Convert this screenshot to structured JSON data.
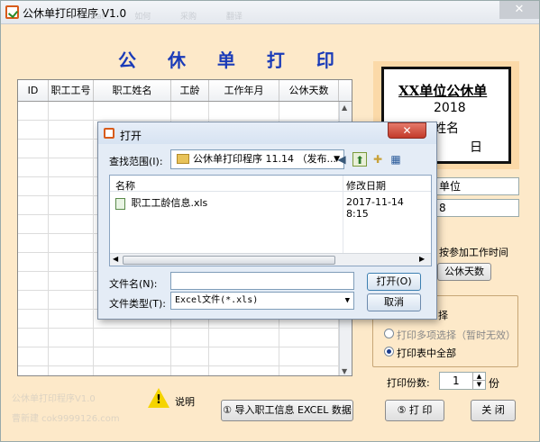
{
  "window": {
    "title": "公休单打印程序 V1.0",
    "menu_ghost": "Cat 如何 采购 翻译",
    "close_label": "✕"
  },
  "main": {
    "heading": "公 休 单 打 印",
    "table_headers": [
      "ID",
      "职工工号",
      "职工姓名",
      "工龄",
      "工作年月",
      "公休天数"
    ]
  },
  "card": {
    "title": "XX单位公休单",
    "year": "2018",
    "name": "姓名",
    "day": "日"
  },
  "side": {
    "field1_tail": "单位",
    "field2_tail": "8",
    "label_join": "按参加工作时间",
    "calc_button": "公休天数",
    "group_tail": "择",
    "radio_multi": "打印多项选择（暂时无效）",
    "radio_all": "打印表中全部",
    "copies_label": "打印份数:",
    "copies_value": "1",
    "copies_unit": "份"
  },
  "footer": {
    "ghost_line1": "公休单打印程序V1.0",
    "ghost_line2": "曹新建 cok9999126.com",
    "help_label": "说明",
    "import_button": "① 导入职工信息 EXCEL 数据",
    "print_button": "⑤ 打 印",
    "close_button": "关 闭"
  },
  "dialog": {
    "title": "打开",
    "close_label": "✕",
    "lookin_label": "查找范围(I):",
    "lookin_value": "公休单打印程序 11.14 （发布...",
    "col_name": "名称",
    "col_modified": "修改日期",
    "file_name": "职工工龄信息.xls",
    "file_date": "2017-11-14 8:15",
    "filename_label": "文件名(N):",
    "filename_value": "",
    "filetype_label": "文件类型(T):",
    "filetype_value": "Excel文件(*.xls)",
    "open_button": "打开(O)",
    "cancel_button": "取消"
  }
}
